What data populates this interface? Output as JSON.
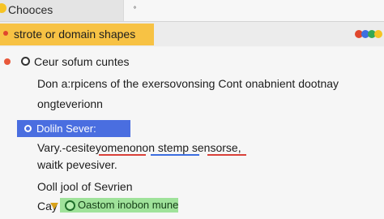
{
  "window": {
    "title": "Chooces",
    "tab_icon": "search-icon"
  },
  "banner": {
    "text": "strote or domain shapes"
  },
  "colors": {
    "accent_yellow": "#f7c244",
    "selected_blue": "#4a6ee0",
    "green_highlight": "#9fe29a",
    "red": "#e0472d"
  },
  "status_dots": [
    {
      "name": "red",
      "color": "#e0472d"
    },
    {
      "name": "blue",
      "color": "#3d6fe0"
    },
    {
      "name": "green",
      "color": "#35a853"
    },
    {
      "name": "yellow",
      "color": "#f6c324"
    }
  ],
  "content": {
    "option1_label": "Ceur sofum cuntes",
    "option1_line1": "Don a:rpicens of the exersovonsing Cont onabnient dootnay",
    "option1_line2": "ongteverionn",
    "selected_option_label": "Doliln Sever:",
    "line3": "Vary.-cesiteyomenonon stemp sensorse,",
    "line4": "waitk pevesiver.",
    "line5": "Ooll jool of Sevrien",
    "last_prefix": "Cay",
    "last_highlight": "Oastom inobon mune"
  }
}
